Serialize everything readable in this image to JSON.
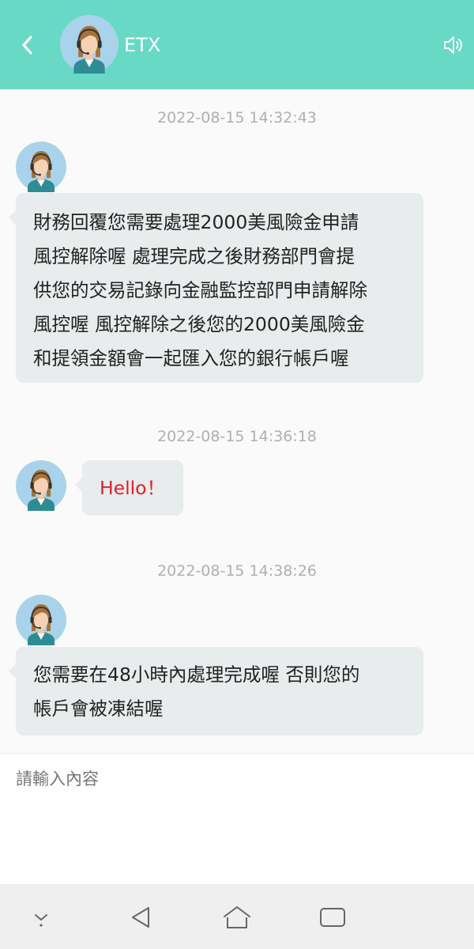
{
  "header": {
    "title": "ETX",
    "back_icon": "chevron-left-icon",
    "speaker_icon": "speaker-icon"
  },
  "colors": {
    "header_bg": "#68d9c5",
    "bubble_bg": "#e8ecec",
    "greeting_text": "#e0202a"
  },
  "messages": [
    {
      "timestamp": "2022-08-15 14:32:43",
      "text": "財務回覆您需要處理2000美風險金申請\n風控解除喔 處理完成之後財務部門會提\n供您的交易記錄向金融監控部門申請解除\n風控喔 風控解除之後您的2000美風險金\n和提領金額會一起匯入您的銀行帳戶喔"
    },
    {
      "timestamp": "2022-08-15 14:36:18",
      "text": "Hello！"
    },
    {
      "timestamp": "2022-08-15 14:38:26",
      "text": "您需要在48小時內處理完成喔 否則您的\n帳戶會被凍結喔"
    }
  ],
  "input": {
    "placeholder": "請輸入內容"
  },
  "navbar": {
    "icons": [
      "hide-keyboard-icon",
      "back-triangle-icon",
      "home-icon",
      "recent-apps-icon"
    ]
  }
}
